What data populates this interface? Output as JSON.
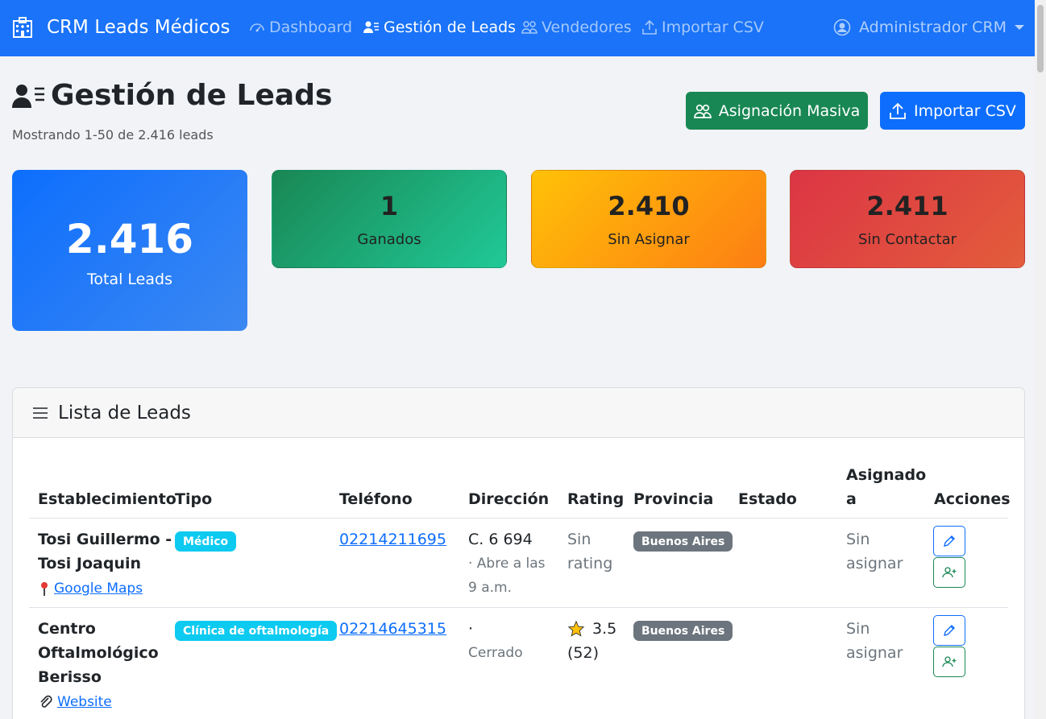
{
  "navbar": {
    "brand": "CRM Leads Médicos",
    "links": [
      {
        "label": "Dashboard",
        "icon": "speedometer-icon"
      },
      {
        "label": "Gestión de Leads",
        "icon": "person-lines-icon",
        "active": true
      },
      {
        "label": "Vendedores",
        "icon": "people-icon"
      },
      {
        "label": "Importar CSV",
        "icon": "upload-icon"
      }
    ],
    "user": "Administrador CRM",
    "color": "#1a73f8"
  },
  "header": {
    "title": "Gestión de Leads",
    "subtitle": "Mostrando 1-50 de 2.416 leads",
    "mass_assign_label": "Asignación Masiva",
    "import_label": "Importar CSV"
  },
  "stats": {
    "total": {
      "value": "2.416",
      "label": "Total Leads"
    },
    "won": {
      "value": "1",
      "label": "Ganados"
    },
    "unassigned": {
      "value": "2.410",
      "label": "Sin Asignar"
    },
    "uncontacted": {
      "value": "2.411",
      "label": "Sin Contactar"
    }
  },
  "panel": {
    "title": "Lista de Leads",
    "columns": [
      "Establecimiento",
      "Tipo",
      "Teléfono",
      "Dirección",
      "Rating",
      "Provincia",
      "Estado",
      "Asignado",
      "a",
      "Acciones"
    ],
    "rows": [
      {
        "name_line1": "Tosi Guillermo -",
        "name_line2": "Tosi Joaquin",
        "link_label": "Google Maps",
        "type": "Médico",
        "phone": "02214211695",
        "address": "C. 6 694",
        "address_sub1": "· Abre a las",
        "address_sub2": "9 a.m.",
        "rating_line1": "Sin",
        "rating_line2": "rating",
        "province": "Buenos Aires",
        "status": "",
        "assigned_line1": "Sin",
        "assigned_line2": "asignar"
      },
      {
        "name_line1": "Centro",
        "name_line2": "Oftalmológico",
        "name_line3": "Berisso",
        "link_label": "Website",
        "type": "Clínica de oftalmología",
        "phone": "02214645315",
        "address": "·",
        "address_sub1": "Cerrado",
        "rating_value": "3.5",
        "rating_count": "(52)",
        "province": "Buenos Aires",
        "status": "",
        "assigned_line1": "Sin",
        "assigned_line2": "asignar"
      }
    ]
  }
}
